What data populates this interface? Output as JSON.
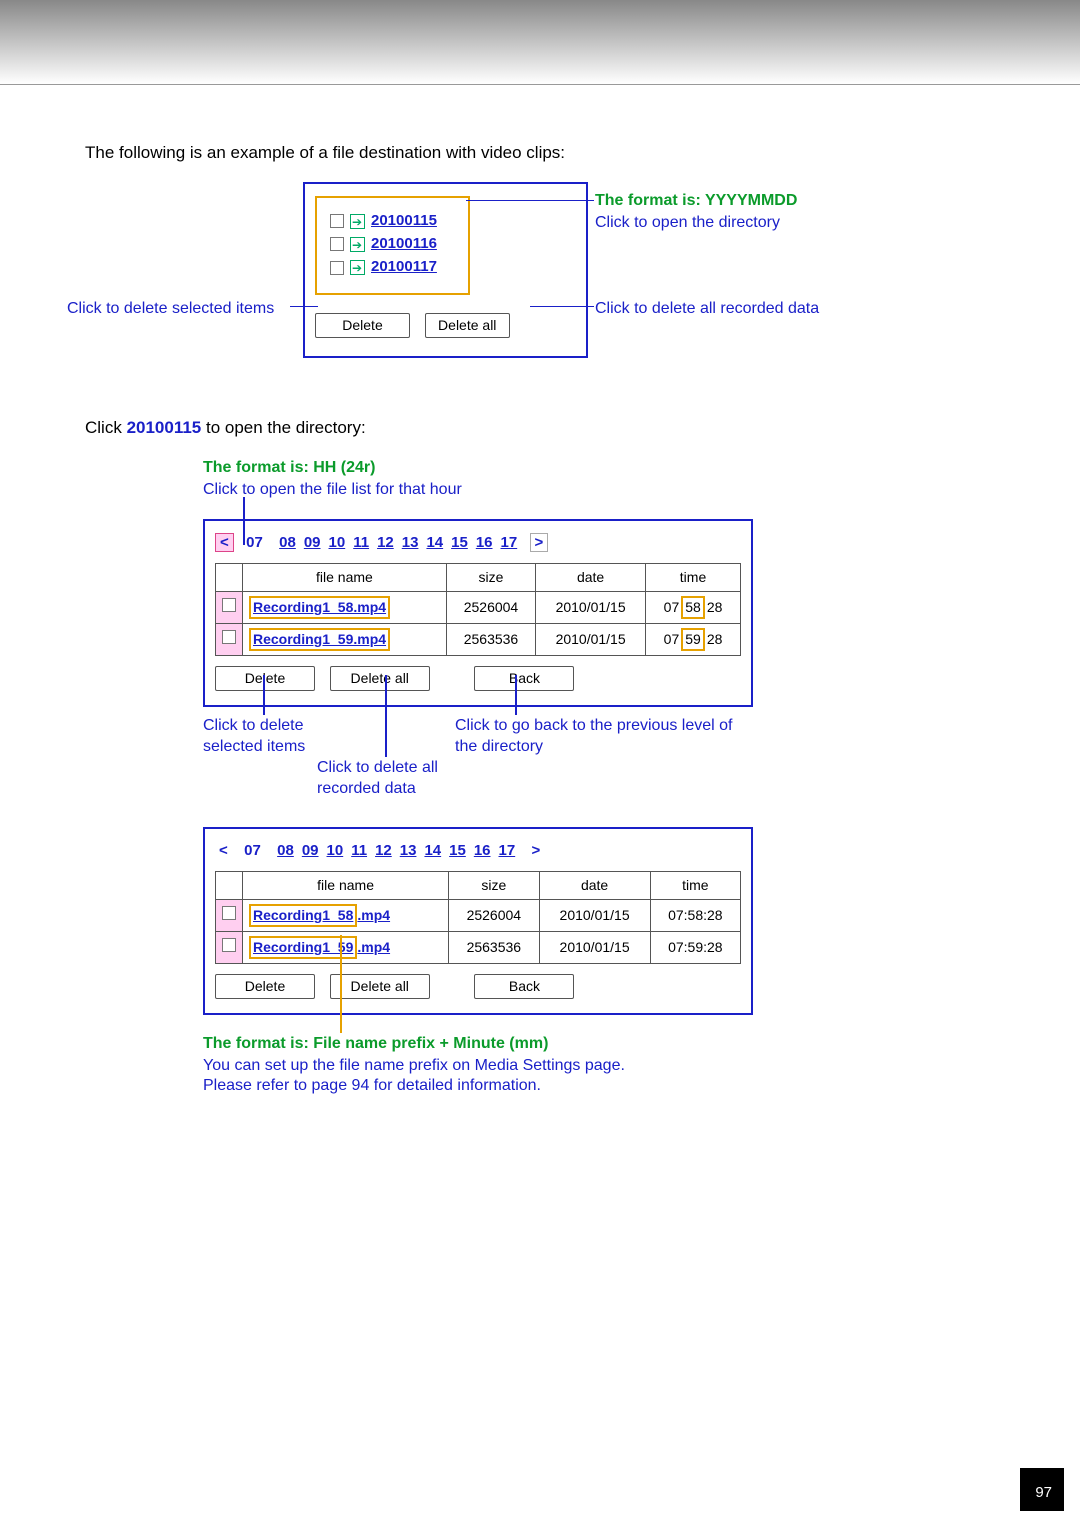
{
  "intro": "The following is an example of a file destination with video clips:",
  "panel1": {
    "dirs": [
      "20100115",
      "20100116",
      "20100117"
    ],
    "delete_btn": "Delete",
    "delete_all_btn": "Delete all"
  },
  "labels1": {
    "left": "Click to delete selected items",
    "right_top": "The format is: YYYYMMDD",
    "right_sub": "Click to open the directory",
    "right_deleteall": "Click to delete all recorded data"
  },
  "line_directory_pre": "Click ",
  "line_directory_link": "20100115",
  "line_directory_post": " to open the directory:",
  "green_hh": "The format is: HH (24r)",
  "blue_hh_sub": "Click to open the file list for that hour",
  "hours": [
    "07",
    "08",
    "09",
    "10",
    "11",
    "12",
    "13",
    "14",
    "15",
    "16",
    "17"
  ],
  "fpanel": {
    "headers": [
      "file name",
      "size",
      "date",
      "time"
    ],
    "rows": [
      {
        "fname": "Recording1  58.mp4",
        "size": "2526004",
        "date": "2010/01/15",
        "time": "07:58:28",
        "mm": "58"
      },
      {
        "fname": "Recording1  59.mp4",
        "size": "2563536",
        "date": "2010/01/15",
        "time": "07:59:28",
        "mm": "59"
      }
    ],
    "delete_btn": "Delete",
    "deleteall_btn": "Delete all",
    "back_btn": "Back"
  },
  "mid_labels": {
    "del_sel": "Click to delete selected items",
    "del_all": "Click to delete all recorded data",
    "back": "Click to go back to the previous level of the directory"
  },
  "green_prefix": "The format is: File name prefix + Minute (mm)",
  "prefix_note1": "You can set up the file name prefix on Media Settings page.",
  "prefix_note2": "Please refer to page 94 for detailed information.",
  "page_no": "97"
}
